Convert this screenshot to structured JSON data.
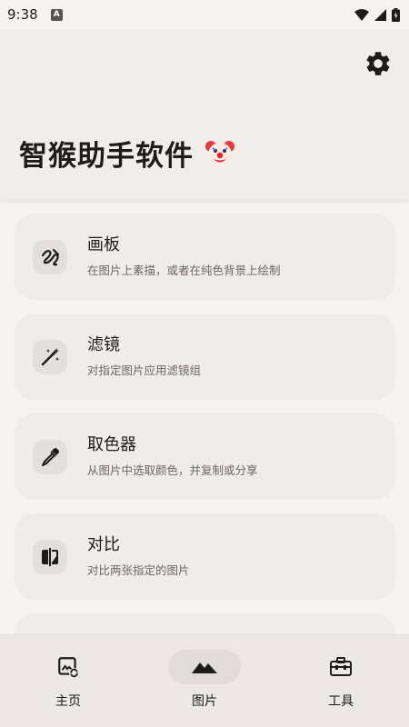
{
  "status_bar": {
    "time": "9:38",
    "notification_badge": "A"
  },
  "header": {
    "title": "智猴助手软件",
    "emoji_icon": "clown-face-icon",
    "settings_icon": "gear-icon"
  },
  "cards": [
    {
      "title": "画板",
      "subtitle": "在图片上素描，或者在纯色背景上绘制",
      "icon": "draw-icon"
    },
    {
      "title": "滤镜",
      "subtitle": "对指定图片应用滤镜组",
      "icon": "magic-wand-icon"
    },
    {
      "title": "取色器",
      "subtitle": "从图片中选取颜色，并复制或分享",
      "icon": "eyedropper-icon"
    },
    {
      "title": "对比",
      "subtitle": "对比两张指定的图片",
      "icon": "compare-icon"
    }
  ],
  "bottom_nav": {
    "items": [
      {
        "label": "主页",
        "icon": "image-sync-icon",
        "active": false
      },
      {
        "label": "图片",
        "icon": "landscape-icon",
        "active": true
      },
      {
        "label": "工具",
        "icon": "toolbox-icon",
        "active": false
      }
    ]
  },
  "colors": {
    "background": "#f7f3f1",
    "header": "#f1edeb",
    "card": "#f0ecea",
    "icon_bg": "#e4dfdd",
    "nav_active_pill": "#e1dbd9",
    "text": "#1f1b1a"
  }
}
